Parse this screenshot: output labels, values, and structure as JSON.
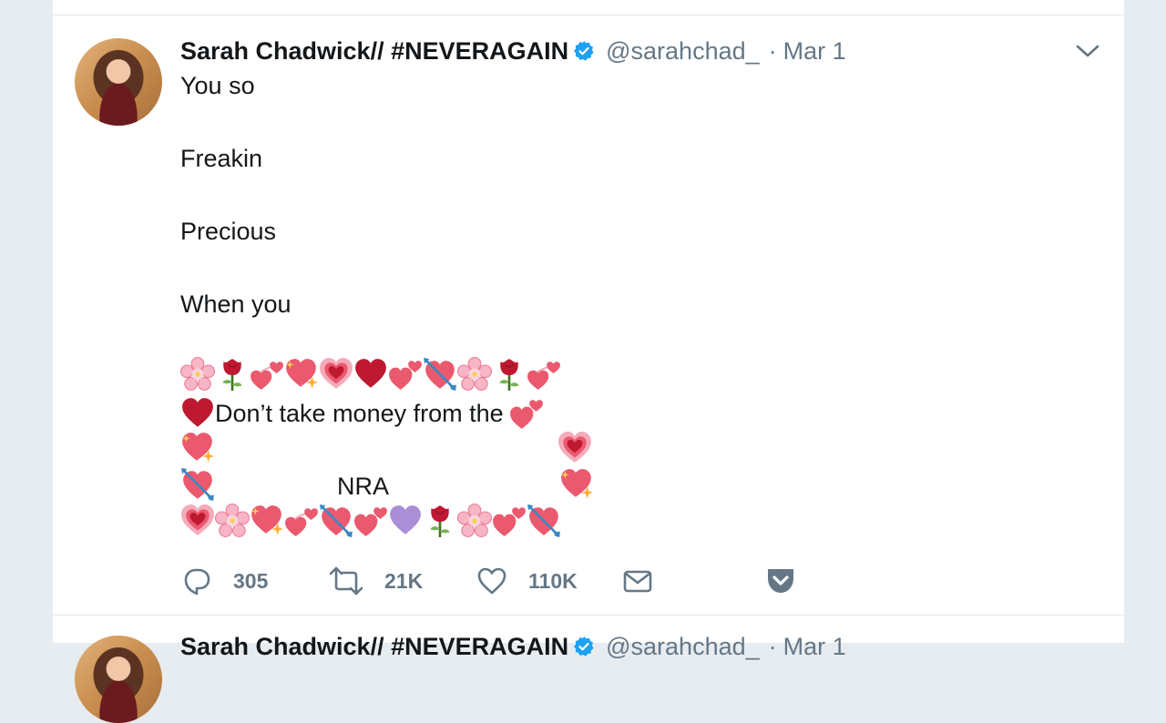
{
  "tweet": {
    "display_name": "Sarah Chadwick// #NEVERAGAIN",
    "handle": "@sarahchad_",
    "separator": "·",
    "date": "Mar 1",
    "lines": {
      "l1": "You so",
      "l2": "Freakin",
      "l3": "Precious",
      "l4": "When you",
      "l5": "Don’t take money from the",
      "l6": "NRA"
    },
    "emoji_rows": {
      "top": [
        "cherry-blossom",
        "rose",
        "two-hearts",
        "sparkling-heart",
        "growing-heart",
        "red-heart",
        "two-hearts",
        "heart-with-arrow",
        "cherry-blossom",
        "rose",
        "revolving-hearts"
      ],
      "bottom": [
        "growing-heart",
        "cherry-blossom",
        "sparkling-heart",
        "revolving-hearts",
        "heart-with-arrow",
        "two-hearts",
        "purple-heart",
        "rose",
        "cherry-blossom",
        "two-hearts",
        "heart-with-arrow"
      ]
    },
    "actions": {
      "reply_count": "305",
      "retweet_count": "21K",
      "like_count": "110K"
    }
  },
  "next_tweet": {
    "display_name": "Sarah Chadwick// #NEVERAGAIN",
    "handle": "@sarahchad_",
    "separator": "·",
    "date": "Mar 1"
  },
  "colors": {
    "background": "#e6ecf0",
    "text": "#14171a",
    "secondary": "#657786",
    "verified": "#1da1f2"
  }
}
